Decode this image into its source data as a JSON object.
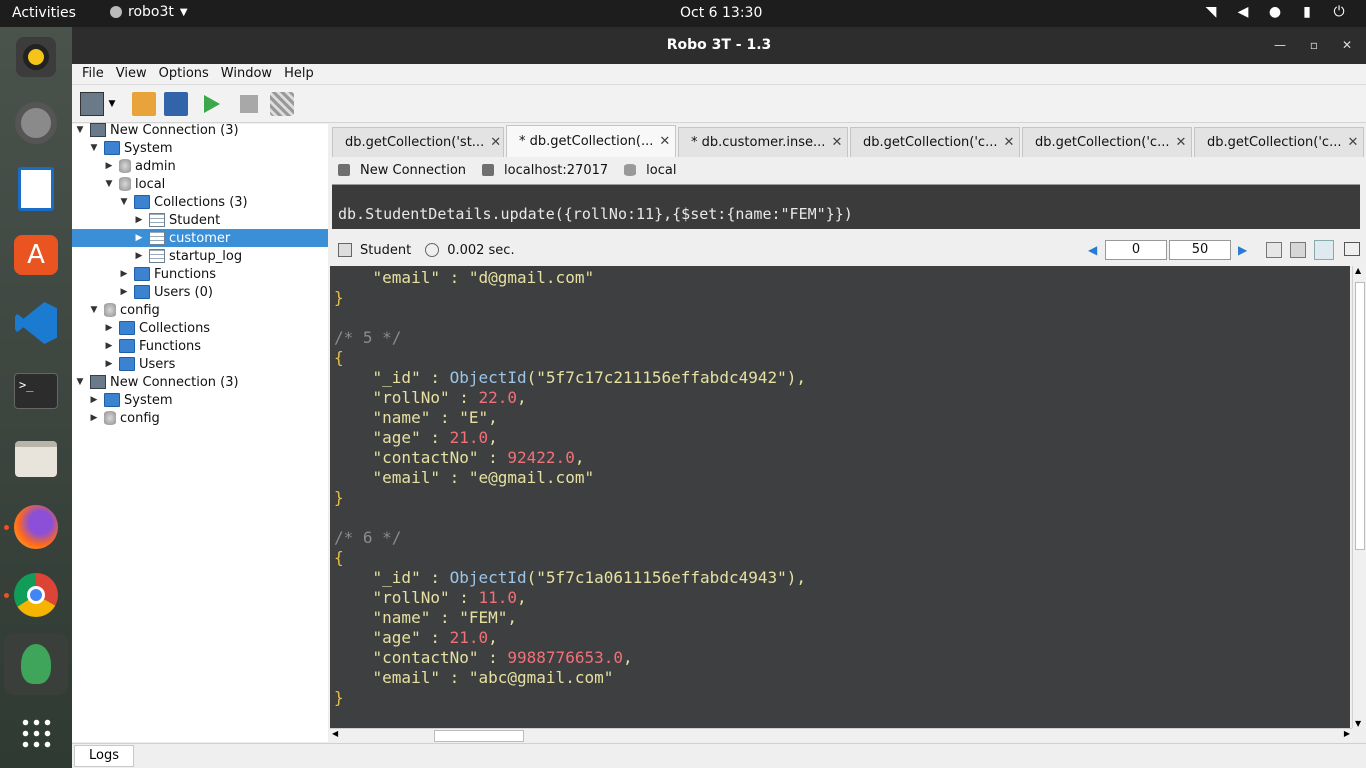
{
  "topbar": {
    "activities": "Activities",
    "app_name": "robo3t",
    "clock": "Oct 6  13:30",
    "tray_icons": [
      "wifi-icon",
      "volume-icon",
      "mic-icon",
      "battery-icon",
      "power-icon"
    ]
  },
  "dock": {
    "items": [
      "rhythmbox",
      "settings",
      "writer",
      "ubuntu-software",
      "vscode",
      "terminal",
      "files",
      "firefox",
      "chrome",
      "robo3t",
      "show-apps"
    ]
  },
  "window": {
    "title": "Robo 3T - 1.3"
  },
  "menu": {
    "items": [
      "File",
      "View",
      "Options",
      "Window",
      "Help"
    ]
  },
  "tree": {
    "nodes": [
      {
        "label": "New Connection (3)",
        "icon": "server-icon",
        "level": 0,
        "expanded": true
      },
      {
        "label": "System",
        "icon": "folder-icon",
        "level": 1,
        "expanded": true
      },
      {
        "label": "admin",
        "icon": "database-icon",
        "level": 2,
        "expanded": false
      },
      {
        "label": "local",
        "icon": "database-icon",
        "level": 2,
        "expanded": true
      },
      {
        "label": "Collections (3)",
        "icon": "folder-icon",
        "level": 3,
        "expanded": true
      },
      {
        "label": "Student",
        "icon": "table-icon",
        "level": 4,
        "expanded": false
      },
      {
        "label": "customer",
        "icon": "table-icon",
        "level": 4,
        "expanded": false,
        "selected": true
      },
      {
        "label": "startup_log",
        "icon": "table-icon",
        "level": 4,
        "expanded": false
      },
      {
        "label": "Functions",
        "icon": "folder-icon",
        "level": 3,
        "expanded": false
      },
      {
        "label": "Users (0)",
        "icon": "folder-icon",
        "level": 3,
        "expanded": false
      },
      {
        "label": "config",
        "icon": "database-icon",
        "level": 1,
        "expanded": true
      },
      {
        "label": "Collections",
        "icon": "folder-icon",
        "level": 2,
        "expanded": false
      },
      {
        "label": "Functions",
        "icon": "folder-icon",
        "level": 2,
        "expanded": false
      },
      {
        "label": "Users",
        "icon": "folder-icon",
        "level": 2,
        "expanded": false
      },
      {
        "label": "New Connection (3)",
        "icon": "server-icon",
        "level": 0,
        "expanded": true
      },
      {
        "label": "System",
        "icon": "folder-icon",
        "level": 1,
        "expanded": false
      },
      {
        "label": "config",
        "icon": "database-icon",
        "level": 1,
        "expanded": false
      }
    ]
  },
  "tabs": [
    {
      "label": "db.getCollection('st..."
    },
    {
      "label": "* db.getCollection(...",
      "active": true
    },
    {
      "label": "* db.customer.inse..."
    },
    {
      "label": "db.getCollection('c..."
    },
    {
      "label": "db.getCollection('c..."
    },
    {
      "label": "db.getCollection('c..."
    }
  ],
  "conn_bar": {
    "connection": "New Connection",
    "host": "localhost:27017",
    "database": "local"
  },
  "editor": {
    "query": "db.StudentDetails.update({rollNo:11},{$set:{name:\"FEM\"}})"
  },
  "result_bar": {
    "collection": "Student",
    "time": "0.002 sec.",
    "skip": "0",
    "limit": "50"
  },
  "results": {
    "lines": [
      {
        "t": "    \"email\" : \"d@gmail.com\"",
        "k": "kv"
      },
      {
        "t": "}",
        "k": "brace"
      },
      {
        "t": "",
        "k": "blank"
      },
      {
        "t": "/* 5 */",
        "k": "com"
      },
      {
        "t": "{",
        "k": "brace"
      },
      {
        "t": "    \"_id\" : ObjectId(\"5f7c17c211156effabdc4942\"),",
        "k": "id"
      },
      {
        "t": "    \"rollNo\" : 22.0,",
        "k": "num"
      },
      {
        "t": "    \"name\" : \"E\",",
        "k": "kv"
      },
      {
        "t": "    \"age\" : 21.0,",
        "k": "num"
      },
      {
        "t": "    \"contactNo\" : 92422.0,",
        "k": "num"
      },
      {
        "t": "    \"email\" : \"e@gmail.com\"",
        "k": "kv"
      },
      {
        "t": "}",
        "k": "brace"
      },
      {
        "t": "",
        "k": "blank"
      },
      {
        "t": "/* 6 */",
        "k": "com"
      },
      {
        "t": "{",
        "k": "brace"
      },
      {
        "t": "    \"_id\" : ObjectId(\"5f7c1a0611156effabdc4943\"),",
        "k": "id"
      },
      {
        "t": "    \"rollNo\" : 11.0,",
        "k": "num"
      },
      {
        "t": "    \"name\" : \"FEM\",",
        "k": "kv"
      },
      {
        "t": "    \"age\" : 21.0,",
        "k": "num"
      },
      {
        "t": "    \"contactNo\" : 9988776653.0,",
        "k": "num"
      },
      {
        "t": "    \"email\" : \"abc@gmail.com\"",
        "k": "kv"
      },
      {
        "t": "}",
        "k": "brace"
      }
    ]
  },
  "logs": {
    "label": "Logs"
  },
  "colors": {
    "selection": "#3a8fd6",
    "results_bg": "#3d3f41",
    "accent_orange": "#e95420"
  }
}
